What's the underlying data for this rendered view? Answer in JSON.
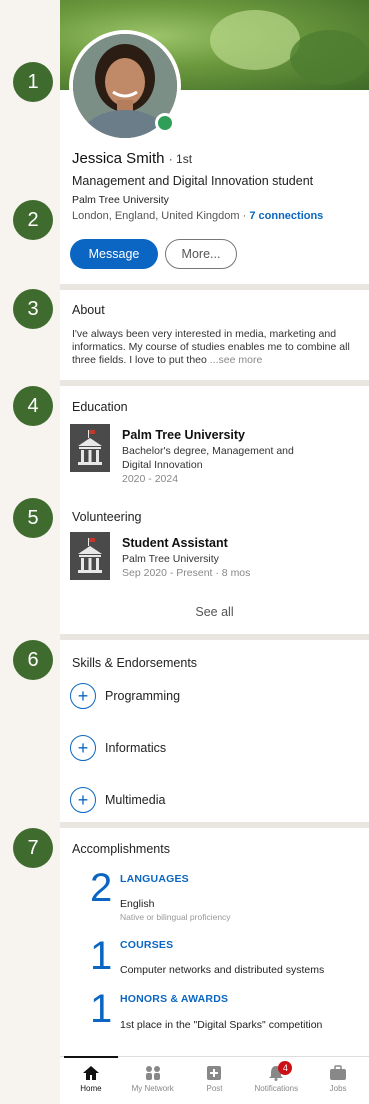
{
  "markers": [
    "1",
    "2",
    "3",
    "4",
    "5",
    "6",
    "7"
  ],
  "profile": {
    "name": "Jessica Smith",
    "degree": "· 1st",
    "headline": "Management and Digital Innovation student",
    "company": "Palm Tree University",
    "location": "London, England, United Kingdom · ",
    "connections": "7 connections",
    "message_label": "Message",
    "more_label": "More..."
  },
  "about": {
    "title": "About",
    "text": "I've always been very interested in media, marketing and informatics. My course of studies enables me to combine all three fields. I love to put theo",
    "see_more": "...see more"
  },
  "education": {
    "title": "Education",
    "school": "Palm Tree University",
    "degree": "Bachelor's degree, Management and",
    "field": "Digital Innovation",
    "years": "2020 - 2024"
  },
  "volunteering": {
    "title": "Volunteering",
    "role": "Student Assistant",
    "org": "Palm Tree University",
    "period": "Sep 2020 - Present · 8 mos",
    "see_all": "See all"
  },
  "skills": {
    "title": "Skills & Endorsements",
    "items": [
      "Programming",
      "Informatics",
      "Multimedia"
    ]
  },
  "accomplishments": {
    "title": "Accomplishments",
    "items": [
      {
        "count": "2",
        "category": "LANGUAGES",
        "detail": "English",
        "sub": "Native or bilingual proficiency"
      },
      {
        "count": "1",
        "category": "COURSES",
        "detail": "Computer networks and distributed systems",
        "sub": ""
      },
      {
        "count": "1",
        "category": "HONORS & AWARDS",
        "detail": "1st place in the \"Digital Sparks\" competition",
        "sub": ""
      }
    ]
  },
  "nav": {
    "items": [
      {
        "label": "Home",
        "icon": "home-icon"
      },
      {
        "label": "My Network",
        "icon": "network-icon"
      },
      {
        "label": "Post",
        "icon": "post-icon"
      },
      {
        "label": "Notifications",
        "icon": "bell-icon"
      },
      {
        "label": "Jobs",
        "icon": "briefcase-icon"
      }
    ],
    "notification_count": "4"
  },
  "colors": {
    "accent": "#0a66c2",
    "marker": "#3f6b2e",
    "online": "#2f9e56",
    "badge": "#cc1016"
  }
}
